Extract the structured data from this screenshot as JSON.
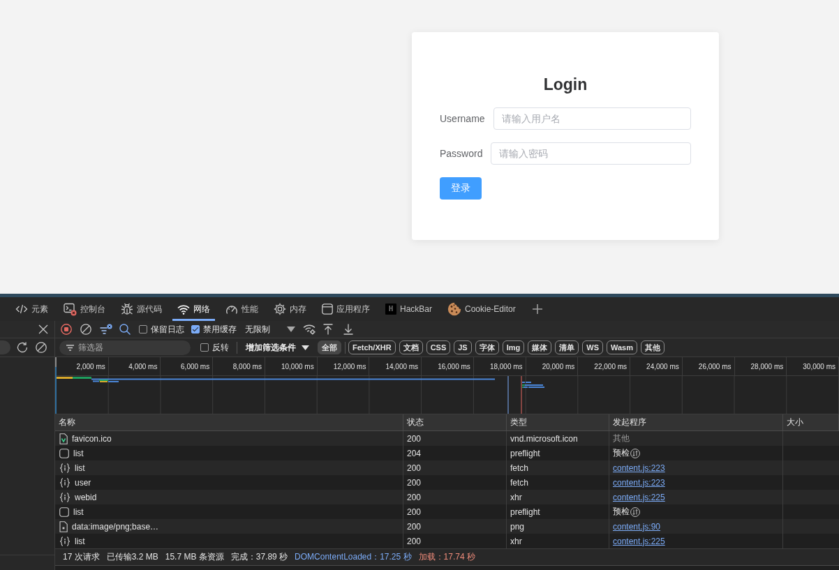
{
  "login": {
    "title": "Login",
    "fields": [
      {
        "label": "Username",
        "placeholder": "请输入用户名"
      },
      {
        "label": "Password",
        "placeholder": "请输入密码"
      }
    ],
    "submit": "登录"
  },
  "devtools": {
    "tabs": [
      {
        "label": "元素",
        "kind": "elements",
        "selected": false
      },
      {
        "label": "控制台",
        "kind": "console",
        "selected": false
      },
      {
        "label": "源代码",
        "kind": "sources",
        "selected": false
      },
      {
        "label": "网络",
        "kind": "network",
        "selected": true
      },
      {
        "label": "性能",
        "kind": "performance",
        "selected": false
      },
      {
        "label": "内存",
        "kind": "memory",
        "selected": false
      },
      {
        "label": "应用程序",
        "kind": "application",
        "selected": false
      },
      {
        "label": "HackBar",
        "kind": "logo",
        "logo": "H",
        "selected": false
      },
      {
        "label": "Cookie-Editor",
        "kind": "cookie",
        "selected": false
      }
    ],
    "toolbar": {
      "recording": true,
      "preserve_log": {
        "label": "保留日志",
        "checked": false
      },
      "disable_cache": {
        "label": "禁用缓存",
        "checked": true
      },
      "throttling": "无限制"
    },
    "filter_bar": {
      "placeholder": "筛选器",
      "invert": {
        "label": "反转",
        "checked": false
      },
      "more_filters": "增加筛选条件",
      "types": [
        {
          "label": "全部",
          "selected": true
        },
        {
          "label": "Fetch/XHR",
          "selected": false
        },
        {
          "label": "文档",
          "selected": false
        },
        {
          "label": "CSS",
          "selected": false
        },
        {
          "label": "JS",
          "selected": false
        },
        {
          "label": "字体",
          "selected": false
        },
        {
          "label": "Img",
          "selected": false
        },
        {
          "label": "媒体",
          "selected": false
        },
        {
          "label": "清单",
          "selected": false
        },
        {
          "label": "WS",
          "selected": false
        },
        {
          "label": "Wasm",
          "selected": false
        },
        {
          "label": "其他",
          "selected": false
        }
      ]
    },
    "timeline": {
      "ticks": [
        "2,000 ms",
        "4,000 ms",
        "6,000 ms",
        "8,000 ms",
        "10,000 ms",
        "12,000 ms",
        "14,000 ms",
        "16,000 ms",
        "18,000 ms",
        "20,000 ms",
        "22,000 ms",
        "24,000 ms",
        "26,000 ms",
        "28,000 ms",
        "30,000 ms"
      ]
    },
    "table": {
      "columns": [
        "名称",
        "状态",
        "类型",
        "发起程序",
        "大小"
      ],
      "rows": [
        {
          "kind": "favicon",
          "name": "favicon.ico",
          "status": "200",
          "type": "vnd.microsoft.icon",
          "initiator": {
            "kind": "other",
            "text": "其他"
          }
        },
        {
          "kind": "preflight",
          "name": "list",
          "status": "204",
          "type": "preflight",
          "initiator": {
            "kind": "preflight",
            "text": "预检"
          }
        },
        {
          "kind": "fetch",
          "name": "list",
          "status": "200",
          "type": "fetch",
          "initiator": {
            "kind": "link",
            "text": "content.js:223"
          }
        },
        {
          "kind": "fetch",
          "name": "user",
          "status": "200",
          "type": "fetch",
          "initiator": {
            "kind": "link",
            "text": "content.js:223"
          }
        },
        {
          "kind": "fetch",
          "name": "webid",
          "status": "200",
          "type": "xhr",
          "initiator": {
            "kind": "link",
            "text": "content.js:225"
          }
        },
        {
          "kind": "preflight",
          "name": "list",
          "status": "200",
          "type": "preflight",
          "initiator": {
            "kind": "preflight",
            "text": "预检"
          }
        },
        {
          "kind": "image",
          "name": "data:image/png;base…",
          "status": "200",
          "type": "png",
          "initiator": {
            "kind": "link",
            "text": "content.js:90"
          }
        },
        {
          "kind": "fetch",
          "name": "list",
          "status": "200",
          "type": "xhr",
          "initiator": {
            "kind": "link",
            "text": "content.js:225"
          }
        }
      ]
    },
    "summary": [
      {
        "kind": "plain",
        "text": "17 次请求"
      },
      {
        "kind": "plain",
        "text": "已传输3.2 MB"
      },
      {
        "kind": "plain",
        "text": "15.7 MB 条资源"
      },
      {
        "kind": "plain",
        "text": "完成：37.89 秒"
      },
      {
        "kind": "dom",
        "text": "DOMContentLoaded：17.25 秒"
      },
      {
        "kind": "load",
        "text": "加载：17.74 秒"
      }
    ]
  }
}
